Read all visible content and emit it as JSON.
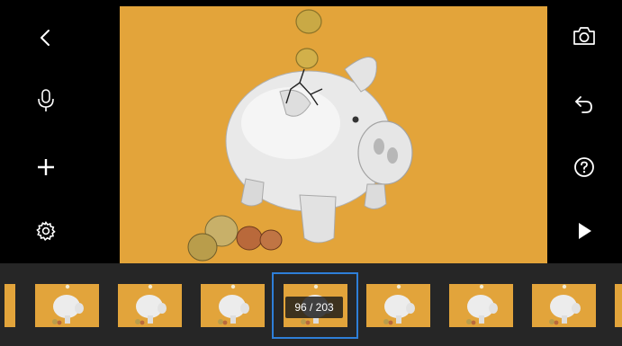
{
  "toolbar_left": {
    "back": {
      "icon": "chevron-left-icon"
    },
    "microphone": {
      "icon": "microphone-icon"
    },
    "add": {
      "icon": "plus-icon"
    },
    "settings": {
      "icon": "gear-icon"
    }
  },
  "toolbar_right": {
    "camera": {
      "icon": "camera-icon"
    },
    "undo": {
      "icon": "undo-icon"
    },
    "help": {
      "icon": "question-circle-icon"
    },
    "play": {
      "icon": "play-icon"
    }
  },
  "preview": {
    "subject": "piggy-bank-with-coins",
    "background_color": "#e3a43a"
  },
  "filmstrip": {
    "current_frame": 96,
    "total_frames": 203,
    "counter_text": "96 / 203",
    "selection_color": "#2e7fd8"
  },
  "colors": {
    "accent": "#2e7fd8",
    "preview_bg": "#e3a43a",
    "strip_bg": "#262626"
  }
}
